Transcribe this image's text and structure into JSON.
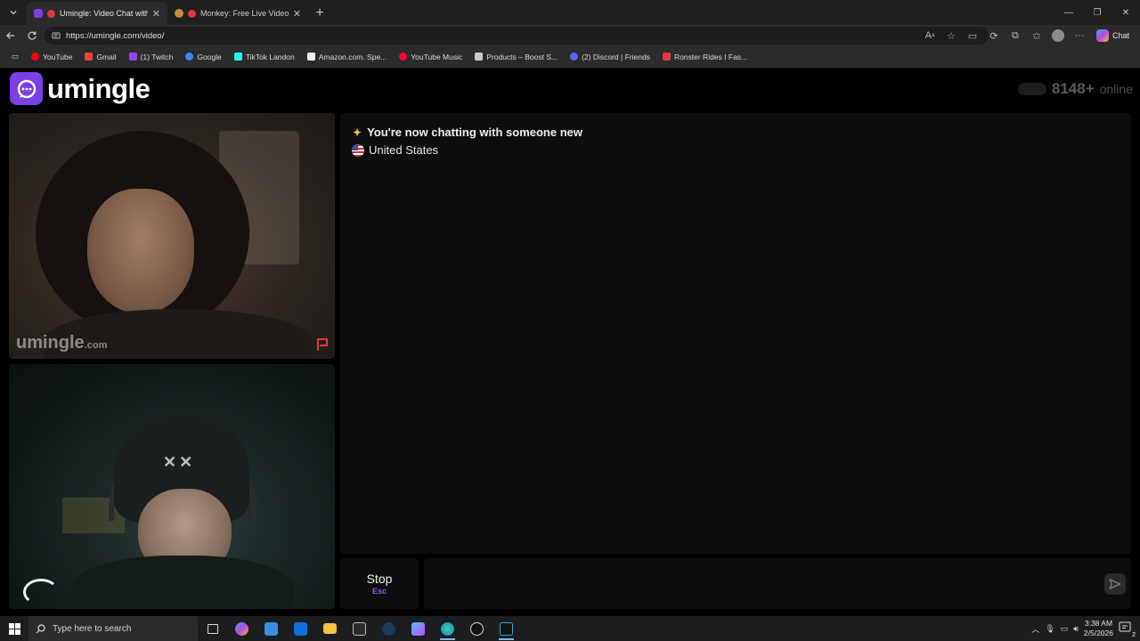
{
  "browser": {
    "tabs": [
      {
        "title": "Umingle: Video Chat with Str",
        "active": true,
        "favicon_color": "#7b3fe4"
      },
      {
        "title": "Monkey: Free Live Video Chat",
        "active": false,
        "favicon_color": "#f0b530"
      }
    ],
    "url": "https://umingle.com/video/",
    "copilot_label": "Chat",
    "bookmarks": [
      {
        "label": "YouTube",
        "color": "#ff0000"
      },
      {
        "label": "Gmail",
        "color": "#ea4335"
      },
      {
        "label": "(1) Twitch",
        "color": "#9146ff"
      },
      {
        "label": "Google",
        "color": "#4285f4"
      },
      {
        "label": "TikTok Landon",
        "color": "#25f4ee"
      },
      {
        "label": "Amazon.com. Spe...",
        "color": "#f0f0f0"
      },
      {
        "label": "YouTube Music",
        "color": "#ff0033"
      },
      {
        "label": "Products – Boost S...",
        "color": "#cccccc"
      },
      {
        "label": "(2) Discord | Friends",
        "color": "#5865f2"
      },
      {
        "label": "Ronster Rides I Fas...",
        "color": "#e0383e"
      }
    ]
  },
  "site": {
    "brand": "umingle",
    "online_count": "8148+",
    "online_label": "online",
    "watermark": "umingle",
    "watermark_suffix": ".com",
    "accent": "#7b3fe4"
  },
  "chat": {
    "status_message": "You're now chatting with someone new",
    "country": "United States"
  },
  "controls": {
    "stop_label": "Stop",
    "stop_shortcut": "Esc",
    "message_placeholder": ""
  },
  "taskbar": {
    "search_placeholder": "Type here to search",
    "time": "3:38 AM",
    "date": "2/5/2026",
    "notification_count": "2"
  }
}
